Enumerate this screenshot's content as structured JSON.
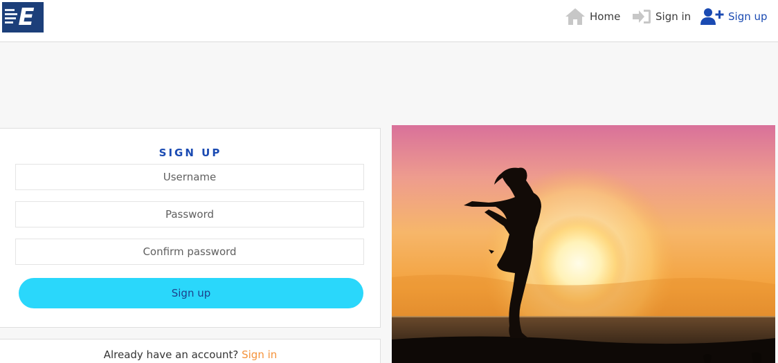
{
  "brand": {
    "logo_letter": "E",
    "logo_color": "#1c3f7a"
  },
  "nav": {
    "home_label": "Home",
    "signin_label": "Sign in",
    "signup_label": "Sign up",
    "home_icon": "home-icon",
    "signin_icon": "sign-in-icon",
    "signup_icon": "user-plus-icon",
    "active_color": "#1a4ab2"
  },
  "form": {
    "title": "SIGN UP",
    "username_placeholder": "Username",
    "password_placeholder": "Password",
    "confirm_placeholder": "Confirm password",
    "submit_label": "Sign up",
    "submit_color": "#2ad7fb"
  },
  "footer": {
    "already_text": "Already have an account?",
    "signin_link": "Sign in",
    "link_color": "#f5923a"
  }
}
